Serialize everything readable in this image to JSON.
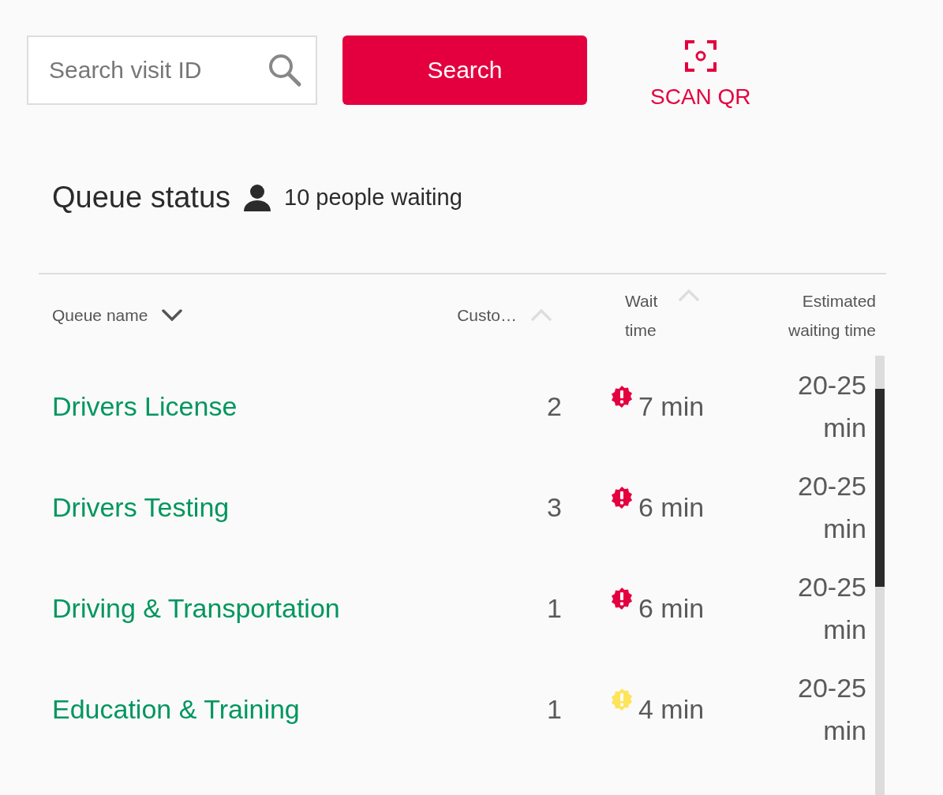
{
  "search": {
    "placeholder": "Search visit ID",
    "button": "Search",
    "scan_label": "SCAN QR"
  },
  "queue_status": {
    "title": "Queue status",
    "waiting": "10 people waiting"
  },
  "table": {
    "columns": [
      {
        "label": "Queue name",
        "descending": true,
        "active": true
      },
      {
        "label": "Custo…",
        "descending": false,
        "active": false
      },
      {
        "label": "Wait time",
        "descending": false,
        "active": false
      },
      {
        "label": "Estimated waiting time"
      }
    ],
    "rows": [
      {
        "name": "Drivers License",
        "customers": "2",
        "wait": "7 min",
        "color": "#e4003f",
        "estimate": "20-25 min"
      },
      {
        "name": "Drivers Testing",
        "customers": "3",
        "wait": "6 min",
        "color": "#e4003f",
        "estimate": "20-25 min"
      },
      {
        "name": "Driving & Transportation",
        "customers": "1",
        "wait": "6 min",
        "color": "#e4003f",
        "estimate": "20-25 min"
      },
      {
        "name": "Education & Training",
        "customers": "1",
        "wait": "4 min",
        "color": "#ffe358",
        "estimate": "20-25 min"
      }
    ]
  }
}
